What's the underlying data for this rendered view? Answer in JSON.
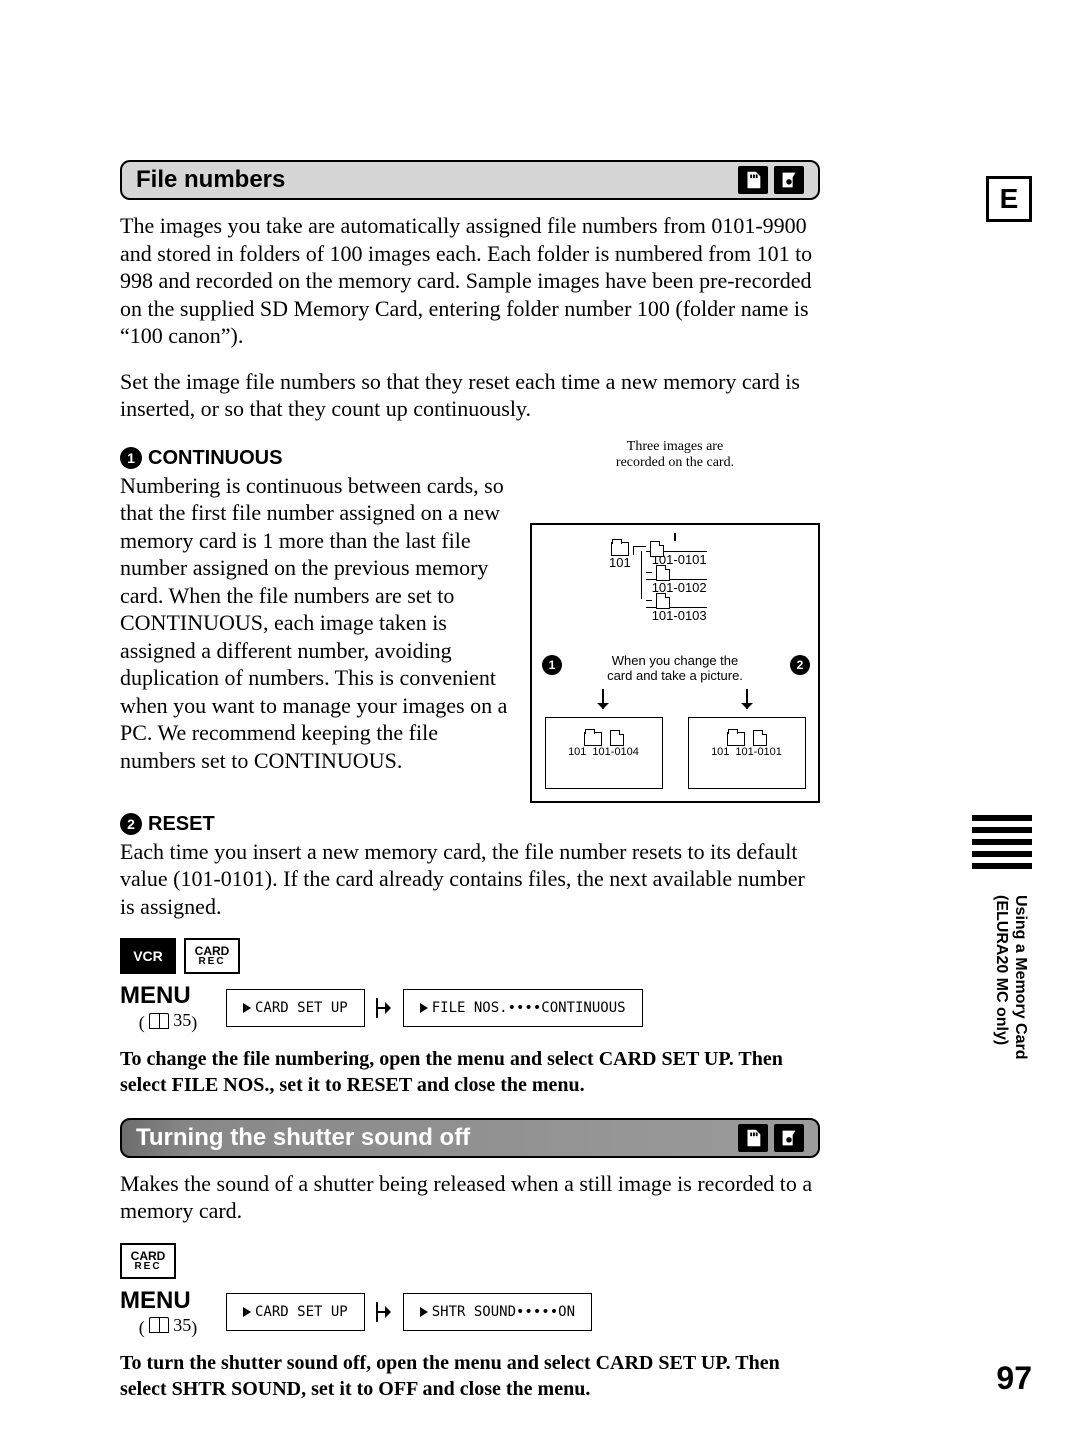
{
  "language_box": "E",
  "page_number": "97",
  "side_label_line1": "Using a Memory Card",
  "side_label_line2": "(ELURA20 MC only)",
  "section1": {
    "title": "File numbers",
    "para1": "The images you take are automatically assigned file numbers from 0101-9900 and stored in folders of 100 images each. Each folder is numbered from 101 to 998 and recorded on the memory card. Sample images have been pre-recorded on the supplied SD Memory Card, entering folder number 100 (folder name is “100 canon”).",
    "para2": "Set the image file numbers so that they reset each time a new memory card is inserted, or so that they count up continuously.",
    "opt1": {
      "num": "1",
      "title": "CONTINUOUS",
      "text": "Numbering is continuous between cards, so that the first file number assigned on a new memory card is 1 more than the last file number assigned on the previous memory card. When the file numbers are set to CONTINUOUS, each image taken is assigned a different number, avoiding duplication of numbers. This is convenient when you want to manage your images on a PC. We recommend keeping the file numbers set to CONTINUOUS."
    },
    "opt2": {
      "num": "2",
      "title": "RESET",
      "text": "Each time you insert a new memory card, the file number resets to its default value (101-0101). If the card already contains files, the next available number is assigned."
    },
    "diagram": {
      "caption": "Three images are\nrecorded on the card.",
      "folder": "101",
      "files": [
        "101-0101",
        "101-0102",
        "101-0103"
      ],
      "midtext": "When you change the\ncard and take a picture.",
      "col1_folder": "101",
      "col1_file": "101-0104",
      "col2_folder": "101",
      "col2_file": "101-0101",
      "mark1": "1",
      "mark2": "2"
    },
    "modes": {
      "m1": "VCR",
      "m2_top": "CARD",
      "m2_bot": "REC"
    },
    "menu": {
      "label": "MENU",
      "ref": "35",
      "box1": "CARD SET UP",
      "box2": "FILE NOS.••••CONTINUOUS"
    },
    "instruction": "To change the file numbering, open the menu and select CARD SET UP. Then select FILE NOS., set it to RESET and close the menu."
  },
  "section2": {
    "title": "Turning the shutter sound off",
    "para": "Makes the sound of a shutter being released when a still image is recorded to a memory card.",
    "modes": {
      "m1_top": "CARD",
      "m1_bot": "REC"
    },
    "menu": {
      "label": "MENU",
      "ref": "35",
      "box1": "CARD SET UP",
      "box2": "SHTR SOUND•••••ON"
    },
    "instruction": "To turn the shutter sound off, open the menu and select CARD SET UP. Then select SHTR SOUND, set it to OFF and close the menu."
  }
}
